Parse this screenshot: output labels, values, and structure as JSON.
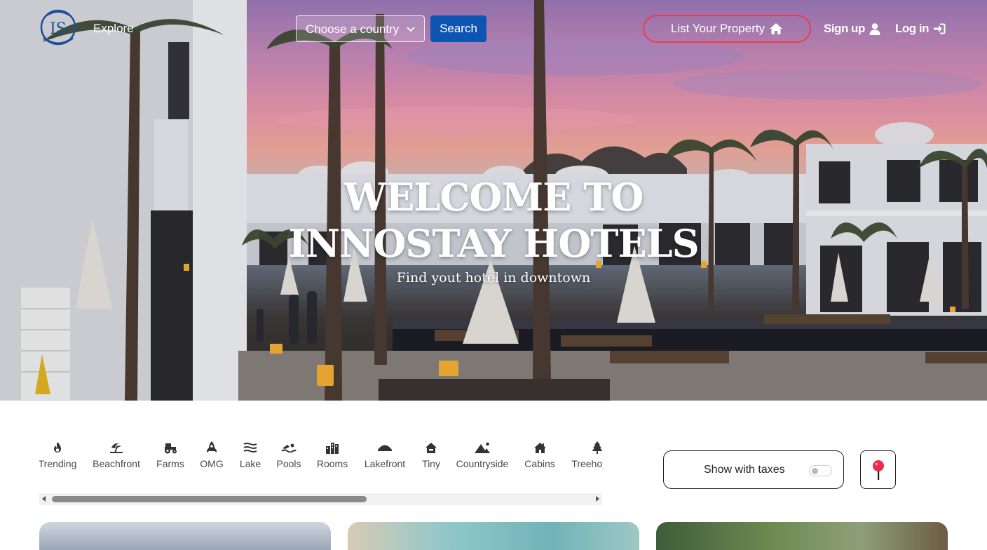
{
  "brand": {
    "logo_text": "IS"
  },
  "nav": {
    "explore": "Explore",
    "country_placeholder": "Choose a country",
    "search": "Search",
    "list_property": "List Your Property",
    "signup": "Sign up",
    "login": "Log in"
  },
  "hero": {
    "title_line1": "WELCOME TO",
    "title_line2": "INNOSTAY HOTELS",
    "subtitle": "Find yout hotel in downtown"
  },
  "filters": [
    {
      "label": "Trending",
      "icon": "fire-icon"
    },
    {
      "label": "Beachfront",
      "icon": "umbrella-beach-icon"
    },
    {
      "label": "Farms",
      "icon": "tractor-icon"
    },
    {
      "label": "OMG",
      "icon": "rocket-icon"
    },
    {
      "label": "Lake",
      "icon": "water-icon"
    },
    {
      "label": "Pools",
      "icon": "swimmer-icon"
    },
    {
      "label": "Rooms",
      "icon": "rooms-icon"
    },
    {
      "label": "Lakefront",
      "icon": "ship-icon"
    },
    {
      "label": "Tiny",
      "icon": "tiny-home-icon"
    },
    {
      "label": "Countryside",
      "icon": "mountain-sun-icon"
    },
    {
      "label": "Cabins",
      "icon": "cabin-icon"
    },
    {
      "label": "Treehouses",
      "icon": "tree-icon"
    }
  ],
  "taxes": {
    "label": "Show with taxes",
    "enabled": false
  },
  "colors": {
    "primary": "#0d55b3",
    "accent": "#ef3b4a"
  }
}
